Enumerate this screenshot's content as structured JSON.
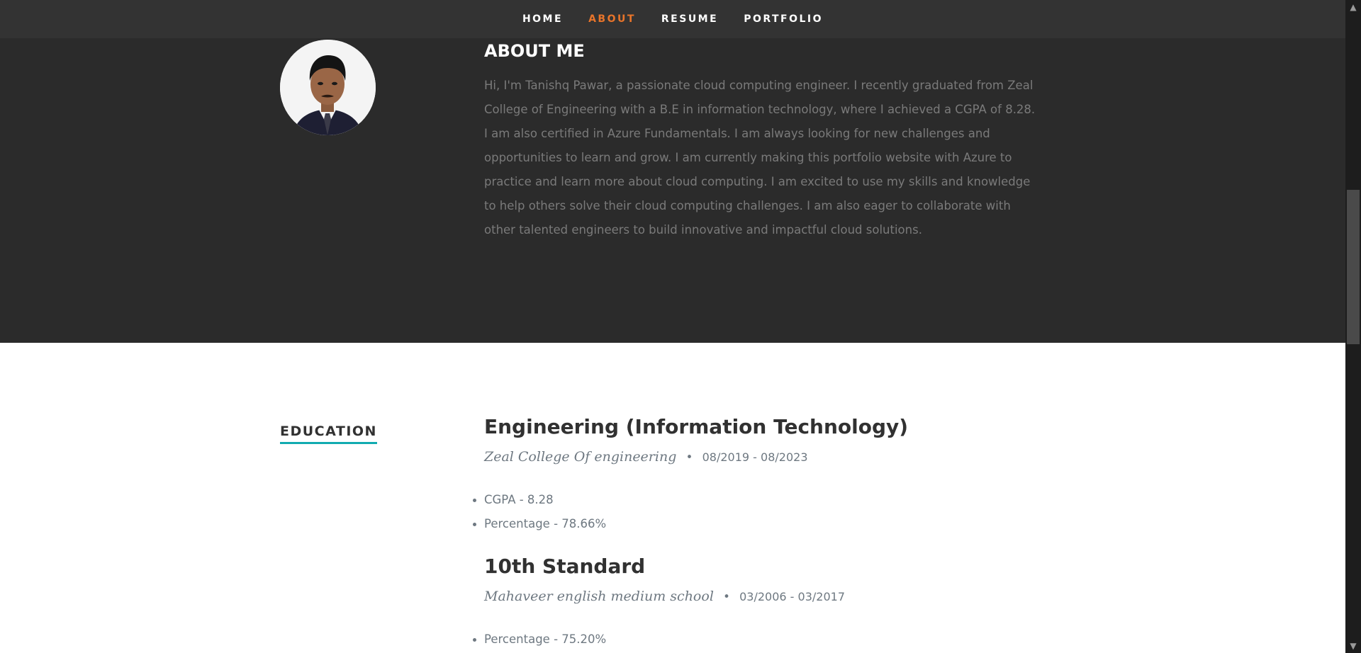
{
  "nav": {
    "items": [
      {
        "label": "HOME",
        "active": false
      },
      {
        "label": "ABOUT",
        "active": true
      },
      {
        "label": "RESUME",
        "active": false
      },
      {
        "label": "PORTFOLIO",
        "active": false
      }
    ],
    "active_color": "#e8742a"
  },
  "about": {
    "title": "ABOUT ME",
    "text": "Hi, I'm Tanishq Pawar, a passionate cloud computing engineer. I recently graduated from Zeal College of Engineering with a B.E in information technology, where I achieved a CGPA of 8.28. I am also certified in Azure Fundamentals. I am always looking for new challenges and opportunities to learn and grow. I am currently making this portfolio website with Azure to practice and learn more about cloud computing. I am excited to use my skills and knowledge to help others solve their cloud computing challenges. I am also eager to collaborate with other talented engineers to build innovative and impactful cloud solutions."
  },
  "education": {
    "heading": "EDUCATION",
    "accent_color": "#11abb0",
    "entries": [
      {
        "degree": "Engineering (Information Technology)",
        "school": "Zeal College Of engineering",
        "separator": "•",
        "dates": "08/2019 - 08/2023",
        "details": [
          "CGPA - 8.28",
          "Percentage - 78.66%"
        ]
      },
      {
        "degree": "10th Standard",
        "school": "Mahaveer english medium school",
        "separator": "•",
        "dates": "03/2006 - 03/2017",
        "details": [
          "Percentage - 75.20%"
        ]
      }
    ]
  },
  "scrollbar": {
    "up_arrow": "▲",
    "down_arrow": "▼"
  }
}
